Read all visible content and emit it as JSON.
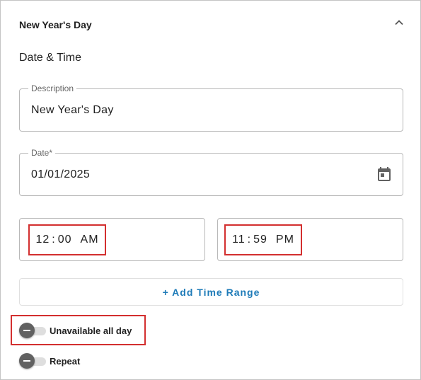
{
  "header": {
    "title": "New Year's Day"
  },
  "section": {
    "title": "Date & Time"
  },
  "description": {
    "label": "Description",
    "value": "New Year's Day"
  },
  "date": {
    "label": "Date*",
    "value": "01/01/2025"
  },
  "start_time": {
    "hour": "12",
    "minute": "00",
    "ampm": "AM"
  },
  "end_time": {
    "hour": "11",
    "minute": "59",
    "ampm": "PM"
  },
  "add_range": {
    "label": "+ Add Time Range"
  },
  "unavailable": {
    "label": "Unavailable all day",
    "checked": false
  },
  "repeat": {
    "label": "Repeat",
    "checked": false
  },
  "colors": {
    "accent": "#1e7bb8",
    "highlight": "#d32f2f",
    "thumb": "#616161"
  }
}
